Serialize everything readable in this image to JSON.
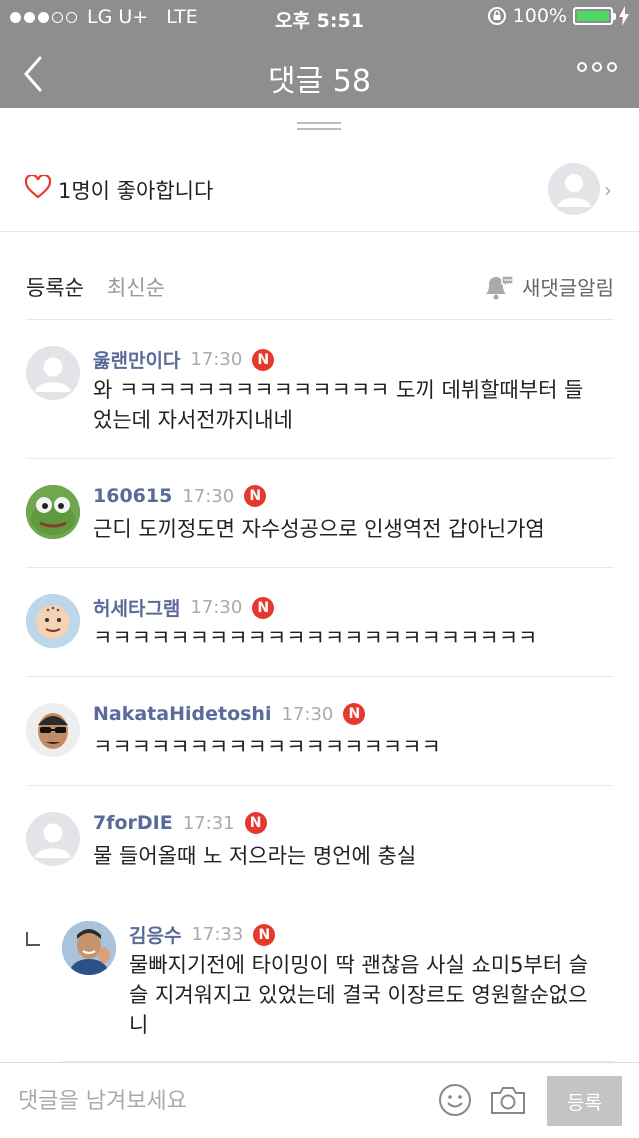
{
  "status_bar": {
    "carrier": "LG U+",
    "network": "LTE",
    "time": "오후 5:51",
    "battery": "100%",
    "battery_level": 1.0,
    "signal_dots": [
      true,
      true,
      true,
      false,
      false
    ]
  },
  "header": {
    "title": "댓글 58",
    "back_icon": "chevron-left-icon",
    "more_icon": "more-dots-icon"
  },
  "likes": {
    "text": "1명이 좋아합니다",
    "icon": "heart-outline-icon"
  },
  "sort": {
    "options": [
      "등록순",
      "최신순"
    ],
    "selected": "등록순",
    "notify_label": "새댓글알림",
    "notify_icon": "bell-icon"
  },
  "colors": {
    "header_bg": "#8e8e8e",
    "author": "#5a6a99",
    "new_badge": "#e8372c",
    "heart": "#e8372c",
    "battery_fill": "#4cd964",
    "submit_disabled": "#c4c4c4"
  },
  "comments": [
    {
      "author": "욿랜만이다",
      "time": "17:30",
      "badge": "N",
      "text": "와 ㅋㅋㅋㅋㅋㅋㅋㅋㅋㅋㅋㅋㅋㅋ 도끼 데뷔할때부터 들었는데 자서전까지내네",
      "avatar": "default-avatar"
    },
    {
      "author": "160615",
      "time": "17:30",
      "badge": "N",
      "text": "근디 도끼정도면 자수성공으로 인생역전 갑아닌가염",
      "avatar": "frog-avatar"
    },
    {
      "author": "허세타그램",
      "time": "17:30",
      "badge": "N",
      "text": "ㅋㅋㅋㅋㅋㅋㅋㅋㅋㅋㅋㅋㅋㅋㅋㅋㅋㅋㅋㅋㅋㅋㅋ",
      "avatar": "cartoon-avatar"
    },
    {
      "author": "NakataHidetoshi",
      "time": "17:30",
      "badge": "N",
      "text": "ㅋㅋㅋㅋㅋㅋㅋㅋㅋㅋㅋㅋㅋㅋㅋㅋㅋㅋ",
      "avatar": "sunglasses-avatar"
    },
    {
      "author": "7forDIE",
      "time": "17:31",
      "badge": "N",
      "text": "물 들어올때 노 저으라는 명언에 충실",
      "avatar": "default-avatar"
    },
    {
      "author": "김응수",
      "time": "17:33",
      "badge": "N",
      "text": "물빠지기전에 타이밍이 딱 괜찮음 사실 쇼미5부터 슬슬 지겨워지고 있었는데 결국 이장르도 영원할순없으니",
      "avatar": "man-avatar",
      "is_reply": true
    }
  ],
  "composer": {
    "placeholder": "댓글을 남겨보세요",
    "submit_label": "등록",
    "emoji_icon": "smiley-icon",
    "camera_icon": "camera-icon"
  }
}
